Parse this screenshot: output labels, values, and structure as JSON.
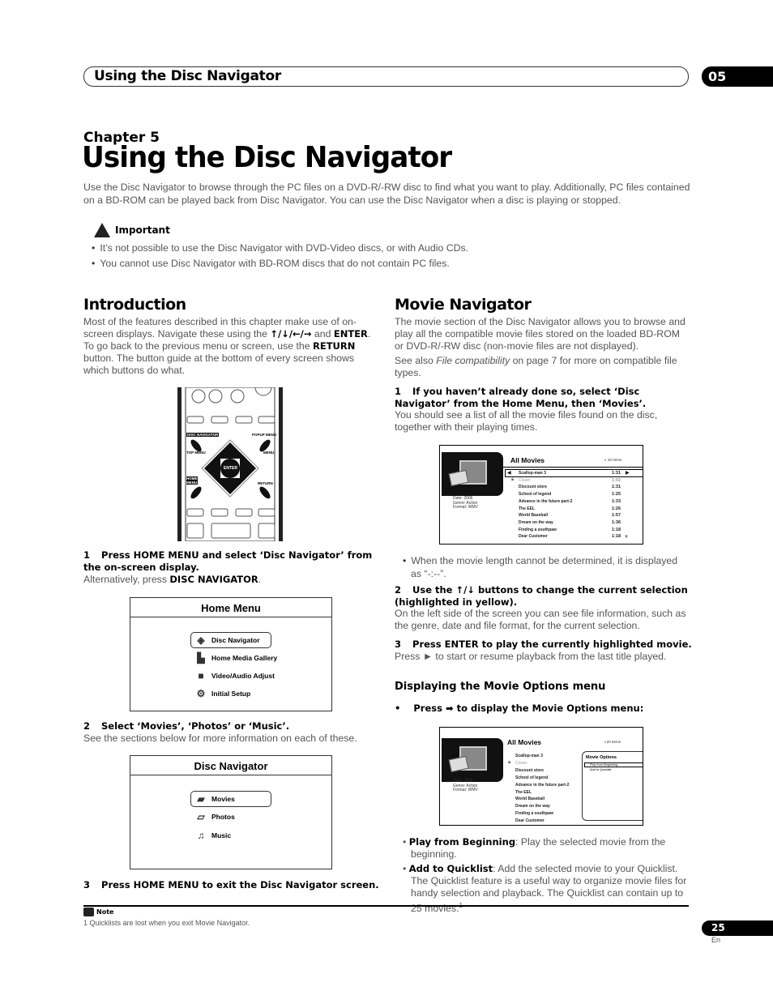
{
  "header": {
    "section_title": "Using the Disc Navigator",
    "chapter_number": "05"
  },
  "chapter": {
    "label": "Chapter 5",
    "title": "Using the Disc Navigator",
    "intro": "Use the Disc Navigator to browse through the PC files on a DVD-R/-RW disc to find what you want to play. Additionally, PC files contained on a BD-ROM can be played back from Disc Navigator. You can use the Disc Navigator when a disc is playing or stopped."
  },
  "important": {
    "heading": "Important",
    "icon": "warning-hand-icon",
    "bullets": [
      "It’s not possible to use the Disc Navigator with DVD-Video discs, or with Audio CDs.",
      "You cannot use Disc Navigator with BD-ROM discs that do not contain PC files."
    ]
  },
  "introduction": {
    "heading": "Introduction",
    "p1_a": "Most of the features described in this chapter make use of on-screen displays. Navigate these using the ",
    "arrows": "↑/↓/←/→",
    "p1_b": " and ",
    "enter": "ENTER",
    "p1_c": ". To go back to the previous menu or screen, use the ",
    "return": "RETURN",
    "p1_d": " button. The button guide at the bottom of every screen shows which buttons do what.",
    "remote": {
      "disc_navigator": "DISC NAVIGATOR",
      "top_menu": "TOP MENU",
      "popup_menu": "POPUP MENU",
      "menu": "MENU",
      "enter": "ENTER",
      "home_menu": "HOME MENU",
      "return": "RETURN"
    },
    "step1_num": "1",
    "step1": "Press HOME MENU and select ‘Disc Navigator’ from the on-screen display.",
    "step1_alt_a": "Alternatively, press ",
    "step1_alt_b": "DISC NAVIGATOR",
    "step1_alt_c": ".",
    "home_menu": {
      "title": "Home Menu",
      "items": [
        {
          "label": "Disc  Navigator",
          "icon": "disc-navigator-icon",
          "selected": true
        },
        {
          "label": "Home Media Gallery",
          "icon": "media-gallery-icon",
          "selected": false
        },
        {
          "label": "Video/Audio Adjust",
          "icon": "video-audio-icon",
          "selected": false
        },
        {
          "label": "Initial Setup",
          "icon": "setup-icon",
          "selected": false
        }
      ]
    },
    "step2_num": "2",
    "step2": "Select ‘Movies’, ‘Photos’ or ‘Music’.",
    "step2_desc": "See the sections below for more information on each of these.",
    "disc_nav": {
      "title": "Disc Navigator",
      "items": [
        {
          "label": "Movies",
          "icon": "movie-icon",
          "selected": true
        },
        {
          "label": "Photos",
          "icon": "photos-icon",
          "selected": false
        },
        {
          "label": "Music",
          "icon": "music-icon",
          "selected": false
        }
      ]
    },
    "step3_num": "3",
    "step3": "Press HOME MENU to exit the Disc Navigator screen."
  },
  "movie_navigator": {
    "heading": "Movie Navigator",
    "p1": "The movie section of the Disc Navigator allows you to browse and play all the compatible movie files stored on the loaded BD-ROM or DVD-R/-RW disc (non-movie files are not displayed).",
    "p2_a": "See also ",
    "p2_italic": "File compatibility",
    "p2_b": " on page 7 for more on compatible file types.",
    "step1_num": "1",
    "step1": "If you haven’t already done so, select ‘Disc Navigator’ from the Home Menu, then ‘Movies’.",
    "step1_desc": "You should see a list of all the movie files found on the disc, together with their playing times.",
    "screen": {
      "title": "All Movies",
      "count": "20 Items",
      "meta": [
        "Date: 2006",
        "Genre: Action",
        "Format: WMV"
      ],
      "movies": [
        {
          "title": "Scallop-man 3",
          "time": "1:31",
          "locked": false
        },
        {
          "title": "Closer",
          "time": "1:02",
          "locked": true
        },
        {
          "title": "Discount store",
          "time": "1:31",
          "locked": false
        },
        {
          "title": "School of legend",
          "time": "1:25",
          "locked": false
        },
        {
          "title": "Advance in the future part-2",
          "time": "1:33",
          "locked": false
        },
        {
          "title": "The EEL",
          "time": "1:26",
          "locked": false
        },
        {
          "title": "World Baseball",
          "time": "1:57",
          "locked": false
        },
        {
          "title": "Dream on the way",
          "time": "1:36",
          "locked": false
        },
        {
          "title": "Finding a southpaw",
          "time": "1:18",
          "locked": false
        },
        {
          "title": "Dear Customer",
          "time": "1:18",
          "locked": false
        }
      ]
    },
    "bullet_length": "When the movie length cannot be determined, it is displayed as “-:--”.",
    "step2_num": "2",
    "step2": "Use the ↑/↓ buttons to change the current selection (highlighted in yellow).",
    "step2_desc": "On the left side of the screen you can see file information, such as the genre, date and file format, for the current selection.",
    "step3_num": "3",
    "step3": "Press ENTER to play the currently highlighted movie.",
    "step3_desc": "Press ► to start or resume playback from the last title played.",
    "options_heading": "Displaying the Movie Options menu",
    "options_step": "Press ➡ to display the Movie Options menu:",
    "options_screen": {
      "title": "Movie  Options",
      "items": [
        "Play from Beginning",
        "Add to Quicklist"
      ]
    },
    "opt1_label": "Play from Beginning",
    "opt1_desc": ": Play the selected movie from the beginning.",
    "opt2_label": "Add to Quicklist",
    "opt2_desc": ": Add the selected movie to your Quicklist. The Quicklist feature is a useful way to organize movie files for handy selection and playback. The Quicklist can contain up to 25 movies.",
    "opt2_sup": "1"
  },
  "note": {
    "heading": "Note",
    "text": "1 Quicklists are lost when you exit Movie Navigator."
  },
  "footer": {
    "page": "25",
    "lang": "En"
  }
}
